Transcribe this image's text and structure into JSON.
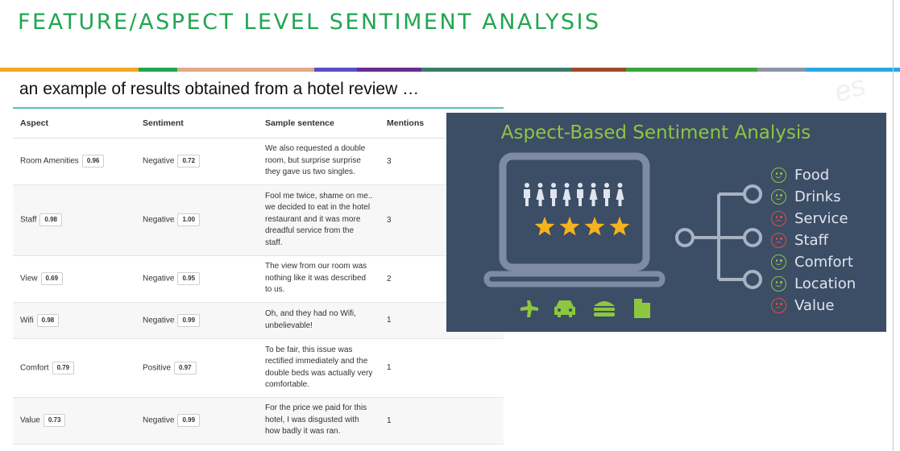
{
  "slide": {
    "title": "FEATURE/ASPECT LEVEL SENTIMENT ANALYSIS",
    "subtitle": "an example of results obtained from a hotel review …",
    "title_color": "#21a650",
    "band_colors": [
      "#f5a623",
      "#21a650",
      "#e0a98a",
      "#5b4ec8",
      "#6a2c91",
      "#3d7a6b",
      "#9b4a2a",
      "#3aa635",
      "#8a96a5",
      "#29a9e0"
    ]
  },
  "table": {
    "headers": [
      "Aspect",
      "Sentiment",
      "Sample sentence",
      "Mentions"
    ],
    "rows": [
      {
        "aspect": "Room Amenities",
        "aspect_score": "0.96",
        "sentiment": "Negative",
        "sentiment_score": "0.72",
        "sentence": "We also requested a double room, but surprise surprise they gave us two singles.",
        "mentions": "3"
      },
      {
        "aspect": "Staff",
        "aspect_score": "0.98",
        "sentiment": "Negative",
        "sentiment_score": "1.00",
        "sentence": "Fool me twice, shame on me.. we decided to eat in the hotel restaurant and it was more dreadful service from the staff.",
        "mentions": "3"
      },
      {
        "aspect": "View",
        "aspect_score": "0.69",
        "sentiment": "Negative",
        "sentiment_score": "0.95",
        "sentence": "The view from our room was nothing like it was described to us.",
        "mentions": "2"
      },
      {
        "aspect": "Wifi",
        "aspect_score": "0.98",
        "sentiment": "Negative",
        "sentiment_score": "0.99",
        "sentence": "Oh, and they had no Wifi, unbelievable!",
        "mentions": "1"
      },
      {
        "aspect": "Comfort",
        "aspect_score": "0.79",
        "sentiment": "Positive",
        "sentiment_score": "0.97",
        "sentence": "To be fair, this issue was rectified immediately and the double beds was actually very comfortable.",
        "mentions": "1"
      },
      {
        "aspect": "Value",
        "aspect_score": "0.73",
        "sentiment": "Negative",
        "sentiment_score": "0.99",
        "sentence": "For the price we paid for this hotel, I was disgusted with how badly it was ran.",
        "mentions": "1"
      }
    ]
  },
  "infographic": {
    "title": "Aspect-Based Sentiment Analysis",
    "title_color": "#8dc63f",
    "background": "#3c4d66",
    "rating_stars": 4,
    "people_icons": 8,
    "bottom_icons": [
      "airplane-icon",
      "car-icon",
      "burger-icon",
      "building-icon"
    ],
    "aspects": [
      {
        "label": "Food",
        "sentiment": "positive"
      },
      {
        "label": "Drinks",
        "sentiment": "positive"
      },
      {
        "label": "Service",
        "sentiment": "negative"
      },
      {
        "label": "Staff",
        "sentiment": "negative"
      },
      {
        "label": "Comfort",
        "sentiment": "positive"
      },
      {
        "label": "Location",
        "sentiment": "positive"
      },
      {
        "label": "Value",
        "sentiment": "negative"
      }
    ],
    "positive_color": "#8dc63f",
    "negative_color": "#e74c3c"
  }
}
